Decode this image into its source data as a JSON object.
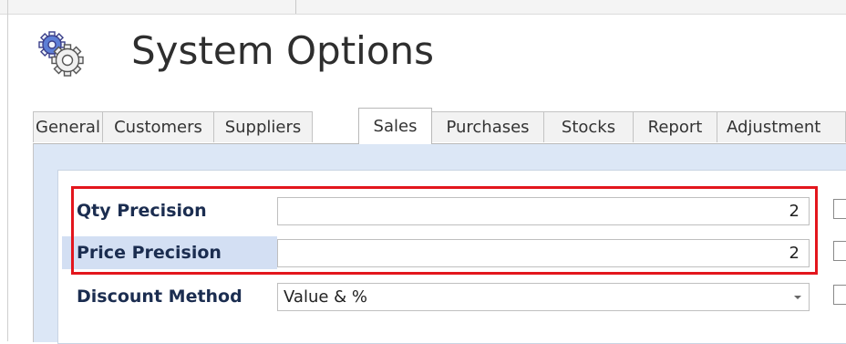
{
  "window": {
    "title": "System Options",
    "title_icon": "gears-icon"
  },
  "tabs": [
    {
      "label": "General",
      "active": false
    },
    {
      "label": "Customers",
      "active": false
    },
    {
      "label": "Suppliers",
      "active": false
    },
    {
      "label": "Sales",
      "active": true
    },
    {
      "label": "Purchases",
      "active": false
    },
    {
      "label": "Stocks",
      "active": false
    },
    {
      "label": "Report",
      "active": false
    },
    {
      "label": "Adjustment",
      "active": false
    }
  ],
  "sales": {
    "qty_precision": {
      "label": "Qty Precision",
      "value": "2"
    },
    "price_precision": {
      "label": "Price Precision",
      "value": "2"
    },
    "discount_method": {
      "label": "Discount Method",
      "value": "Value & %"
    }
  },
  "colors": {
    "highlight_border": "#e3161d",
    "panel_background": "#dce7f6",
    "label_text": "#1b2d50"
  }
}
